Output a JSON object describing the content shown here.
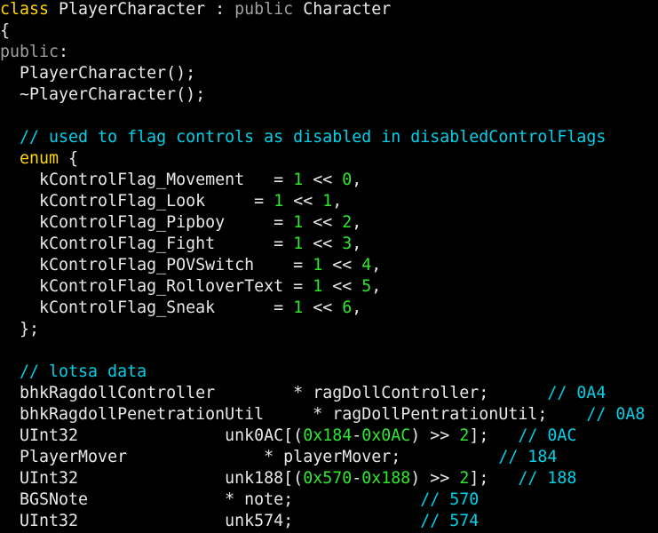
{
  "colors": {
    "background": "#000000",
    "keyword": "#ffd700",
    "keyword_gray": "#a0a0a0",
    "comment": "#00d0e8",
    "number": "#2ee82e",
    "plain": "#e8e8e8"
  },
  "lines": [
    [
      {
        "t": "class",
        "c": "k"
      },
      {
        "t": " PlayerCharacter : ",
        "c": "p"
      },
      {
        "t": "public",
        "c": "g"
      },
      {
        "t": " Character",
        "c": "p"
      }
    ],
    [
      {
        "t": "{",
        "c": "p"
      }
    ],
    [
      {
        "t": "public",
        "c": "g"
      },
      {
        "t": ":",
        "c": "p"
      }
    ],
    [
      {
        "t": "  PlayerCharacter();",
        "c": "p"
      }
    ],
    [
      {
        "t": "  ~PlayerCharacter();",
        "c": "p"
      }
    ],
    [],
    [
      {
        "t": "  // used to flag controls as disabled in disabledControlFlags",
        "c": "c"
      }
    ],
    [
      {
        "t": "  ",
        "c": "p"
      },
      {
        "t": "enum",
        "c": "k"
      },
      {
        "t": " {",
        "c": "p"
      }
    ],
    [
      {
        "t": "    kControlFlag_Movement   = ",
        "c": "p"
      },
      {
        "t": "1",
        "c": "n"
      },
      {
        "t": " << ",
        "c": "p"
      },
      {
        "t": "0",
        "c": "n"
      },
      {
        "t": ",",
        "c": "p"
      }
    ],
    [
      {
        "t": "    kControlFlag_Look     = ",
        "c": "p"
      },
      {
        "t": "1",
        "c": "n"
      },
      {
        "t": " << ",
        "c": "p"
      },
      {
        "t": "1",
        "c": "n"
      },
      {
        "t": ",",
        "c": "p"
      }
    ],
    [
      {
        "t": "    kControlFlag_Pipboy     = ",
        "c": "p"
      },
      {
        "t": "1",
        "c": "n"
      },
      {
        "t": " << ",
        "c": "p"
      },
      {
        "t": "2",
        "c": "n"
      },
      {
        "t": ",",
        "c": "p"
      }
    ],
    [
      {
        "t": "    kControlFlag_Fight      = ",
        "c": "p"
      },
      {
        "t": "1",
        "c": "n"
      },
      {
        "t": " << ",
        "c": "p"
      },
      {
        "t": "3",
        "c": "n"
      },
      {
        "t": ",",
        "c": "p"
      }
    ],
    [
      {
        "t": "    kControlFlag_POVSwitch    = ",
        "c": "p"
      },
      {
        "t": "1",
        "c": "n"
      },
      {
        "t": " << ",
        "c": "p"
      },
      {
        "t": "4",
        "c": "n"
      },
      {
        "t": ",",
        "c": "p"
      }
    ],
    [
      {
        "t": "    kControlFlag_RolloverText = ",
        "c": "p"
      },
      {
        "t": "1",
        "c": "n"
      },
      {
        "t": " << ",
        "c": "p"
      },
      {
        "t": "5",
        "c": "n"
      },
      {
        "t": ",",
        "c": "p"
      }
    ],
    [
      {
        "t": "    kControlFlag_Sneak      = ",
        "c": "p"
      },
      {
        "t": "1",
        "c": "n"
      },
      {
        "t": " << ",
        "c": "p"
      },
      {
        "t": "6",
        "c": "n"
      },
      {
        "t": ",",
        "c": "p"
      }
    ],
    [
      {
        "t": "  };",
        "c": "p"
      }
    ],
    [],
    [
      {
        "t": "  // lotsa data",
        "c": "c"
      }
    ],
    [
      {
        "t": "  bhkRagdollController        * ragDollController;      ",
        "c": "p"
      },
      {
        "t": "// 0A4",
        "c": "c"
      }
    ],
    [
      {
        "t": "  bhkRagdollPenetrationUtil     * ragDollPentrationUtil;    ",
        "c": "p"
      },
      {
        "t": "// 0A8",
        "c": "c"
      }
    ],
    [
      {
        "t": "  UInt32               unk0AC[(",
        "c": "p"
      },
      {
        "t": "0x184",
        "c": "n"
      },
      {
        "t": "-",
        "c": "p"
      },
      {
        "t": "0x0AC",
        "c": "n"
      },
      {
        "t": ") >> ",
        "c": "p"
      },
      {
        "t": "2",
        "c": "n"
      },
      {
        "t": "];   ",
        "c": "p"
      },
      {
        "t": "// 0AC",
        "c": "c"
      }
    ],
    [
      {
        "t": "  PlayerMover              * playerMover;          ",
        "c": "p"
      },
      {
        "t": "// 184",
        "c": "c"
      }
    ],
    [
      {
        "t": "  UInt32               unk188[(",
        "c": "p"
      },
      {
        "t": "0x570",
        "c": "n"
      },
      {
        "t": "-",
        "c": "p"
      },
      {
        "t": "0x188",
        "c": "n"
      },
      {
        "t": ") >> ",
        "c": "p"
      },
      {
        "t": "2",
        "c": "n"
      },
      {
        "t": "];   ",
        "c": "p"
      },
      {
        "t": "// 188",
        "c": "c"
      }
    ],
    [
      {
        "t": "  BGSNote              * note;             ",
        "c": "p"
      },
      {
        "t": "// 570",
        "c": "c"
      }
    ],
    [
      {
        "t": "  UInt32               unk574;             ",
        "c": "p"
      },
      {
        "t": "// 574",
        "c": "c"
      }
    ]
  ]
}
